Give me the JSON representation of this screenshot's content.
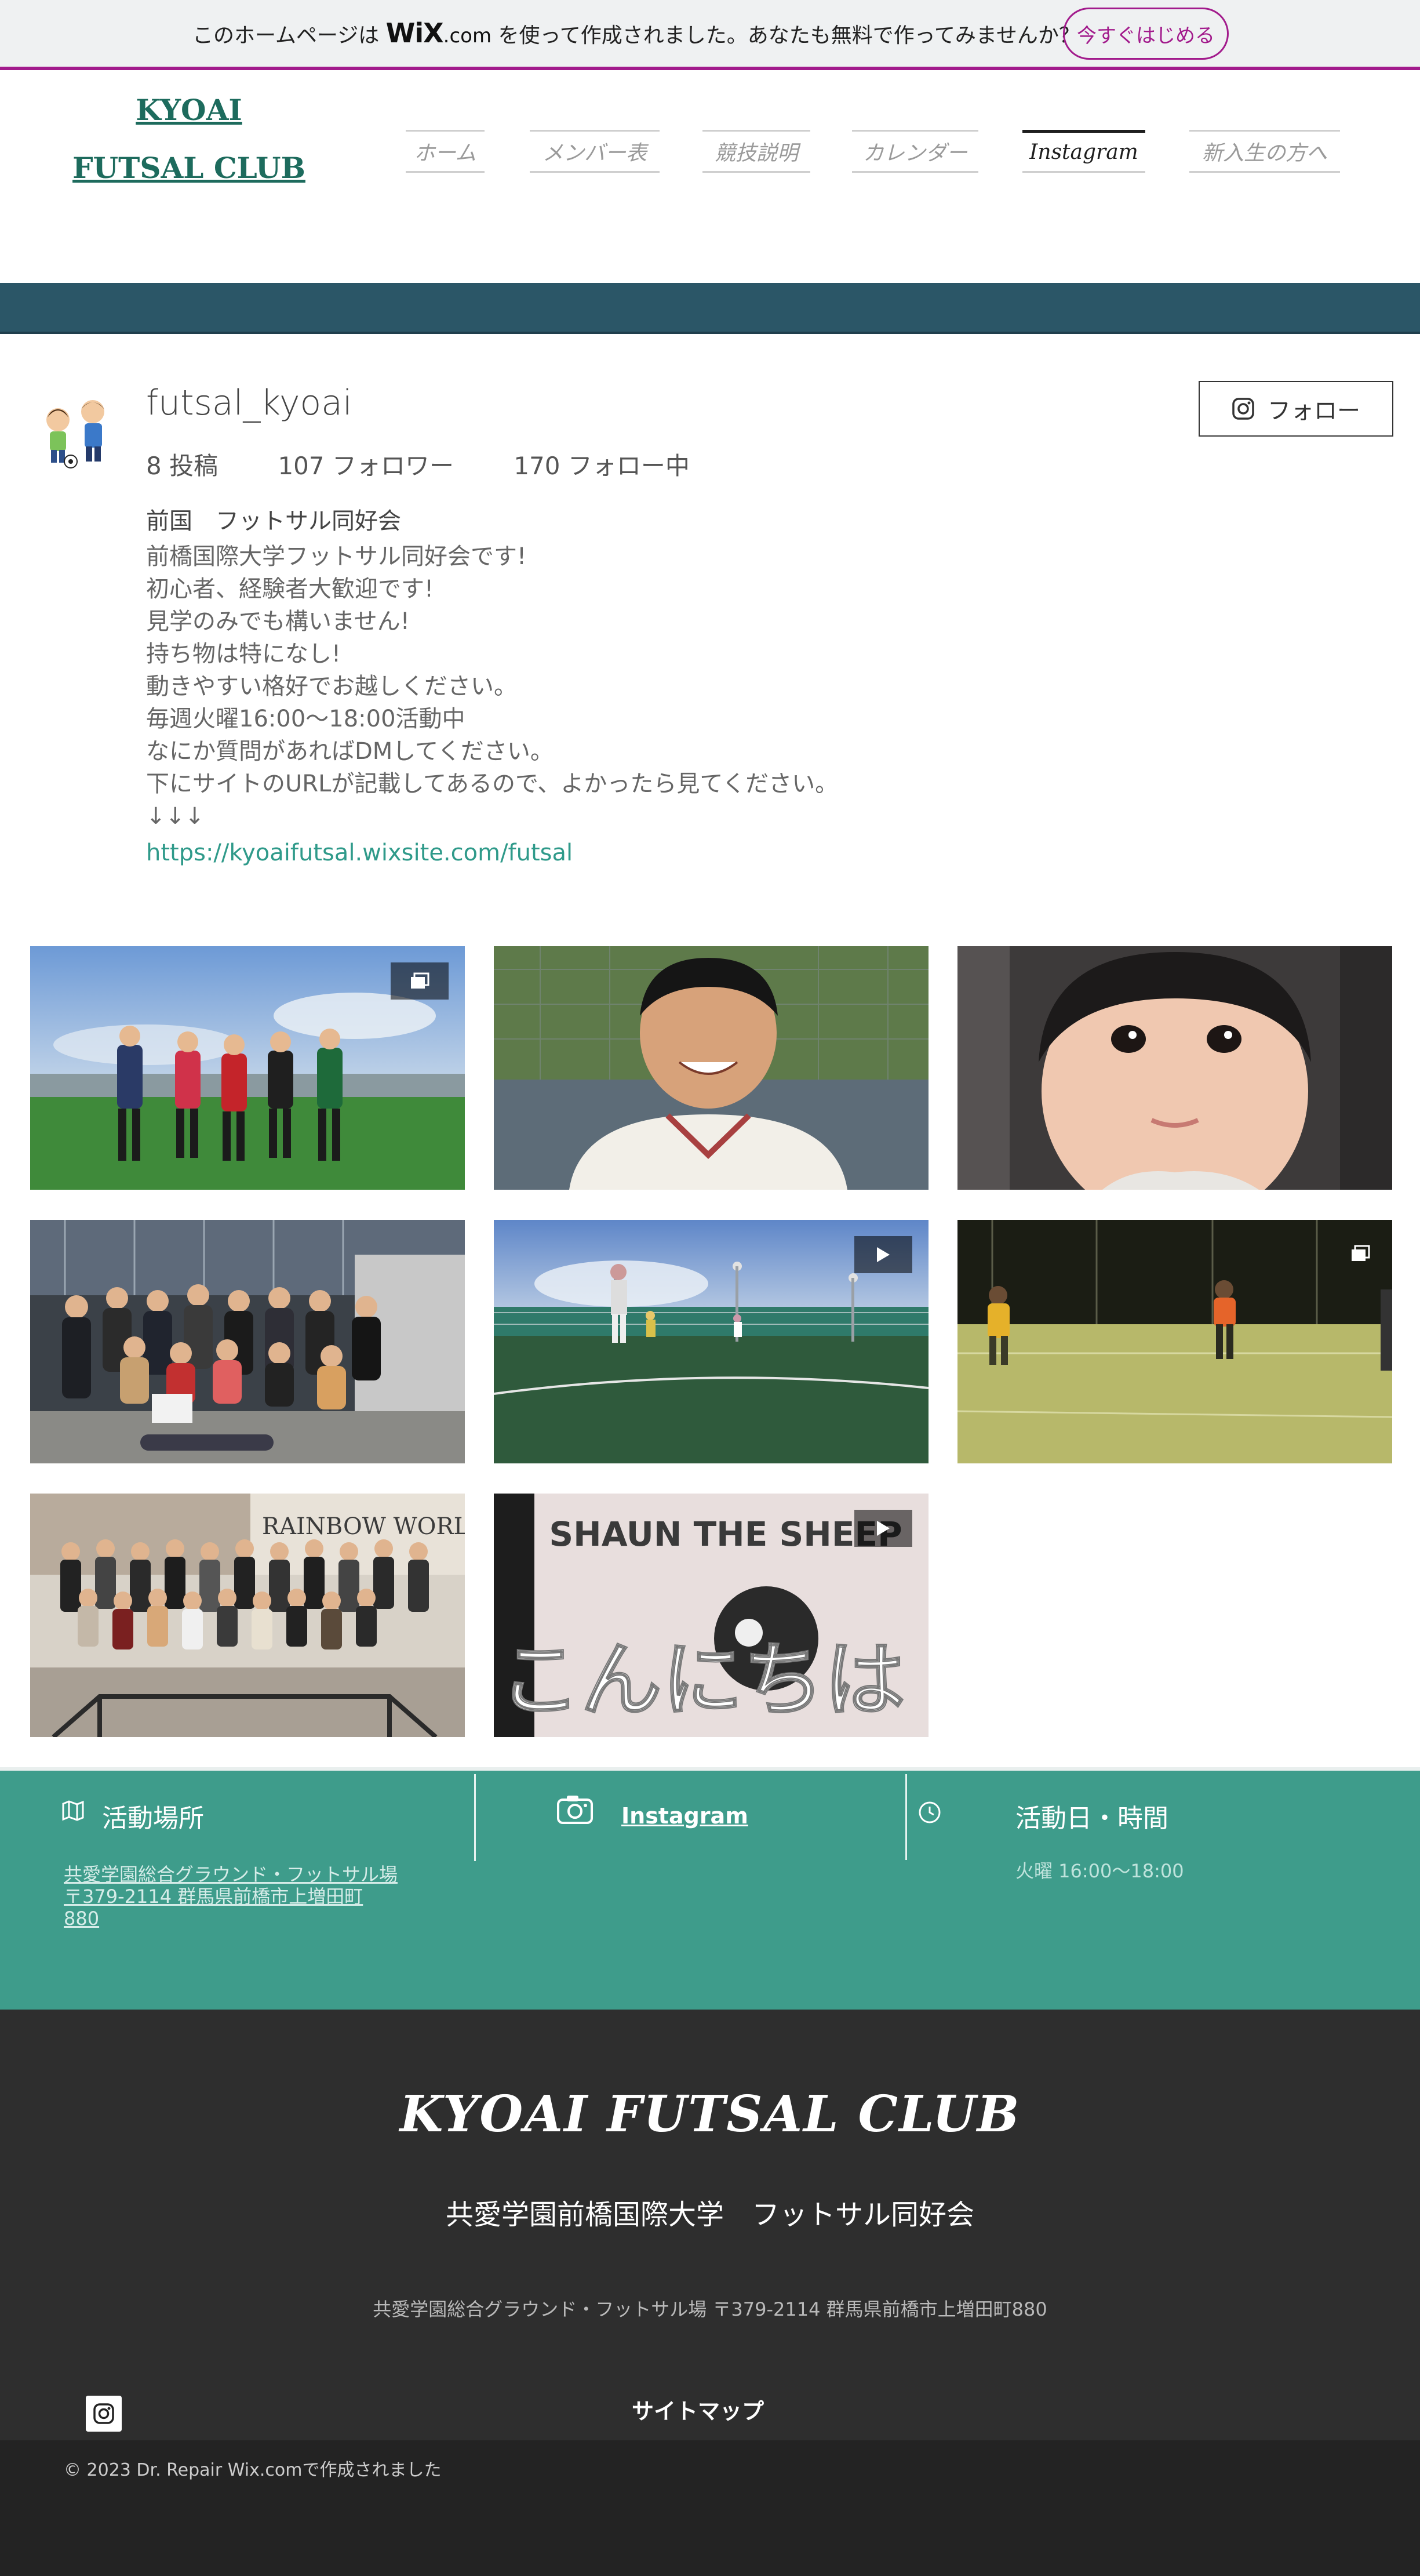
{
  "wix_banner": {
    "text_before": "このホームページは",
    "wix_logo": "WiX",
    "wix_com": ".com",
    "text_after": "を使って作成されました。あなたも無料で作ってみませんか？",
    "start_button": "今すぐはじめる",
    "accent_color": "#a21b8c"
  },
  "header": {
    "logo_line1": "KYOAI",
    "logo_line2": "FUTSAL CLUB",
    "nav": [
      {
        "label": "ホーム",
        "active": false
      },
      {
        "label": "メンバー表",
        "active": false
      },
      {
        "label": "競技説明",
        "active": false
      },
      {
        "label": "カレンダー",
        "active": false
      },
      {
        "label": "Instagram",
        "active": true
      },
      {
        "label": "新入生の方へ",
        "active": false
      }
    ]
  },
  "profile": {
    "username": "futsal_kyoai",
    "posts": "8 投稿",
    "followers": "107 フォロワー",
    "following": "170 フォロー中",
    "follow_button": "フォロー",
    "bio_name": "前国　フットサル同好会",
    "bio_lines": [
      "前橋国際大学フットサル同好会です!",
      "初心者、経験者大歓迎です!",
      "見学のみでも構いません!",
      "持ち物は特になし!",
      "動きやすい格好でお越しください。",
      "毎週火曜16:00～18:00活動中",
      "なにか質問があればDMしてください。",
      "下にサイトのURLが記載してあるので、よかったら見てください。",
      "↓↓↓"
    ],
    "link": "https://kyoaifutsal.wixsite.com/futsal"
  },
  "posts": [
    {
      "type": "carousel",
      "icon": "carousel-icon"
    },
    {
      "type": "image",
      "icon": ""
    },
    {
      "type": "image",
      "icon": ""
    },
    {
      "type": "image",
      "icon": ""
    },
    {
      "type": "video",
      "icon": "play-icon"
    },
    {
      "type": "carousel",
      "icon": "carousel-icon"
    },
    {
      "type": "image",
      "icon": ""
    },
    {
      "type": "video",
      "icon": "play-icon"
    }
  ],
  "post_overlay_texts": {
    "sheep_shirt": "SHAUN THE SHEEP",
    "greeting": "こんにちは"
  },
  "info": {
    "location_title": "活動場所",
    "location_lines": [
      "共愛学園総合グラウンド・フットサル場",
      "〒379-2114 群馬県前橋市上増田町",
      "880"
    ],
    "instagram_label": "Instagram",
    "schedule_title": "活動日・時間",
    "schedule_value": "火曜 16:00～18:00",
    "bg_color": "#3e9c8b"
  },
  "footer": {
    "logo": "KYOAI FUTSAL CLUB",
    "org": "共愛学園前橋国際大学　フットサル同好会",
    "address": "共愛学園総合グラウンド・フットサル場 〒379-2114 群馬県前橋市上増田町880",
    "sitemap": "サイトマップ",
    "copyright": "© 2023  Dr. Repair  Wix.comで作成されました"
  }
}
